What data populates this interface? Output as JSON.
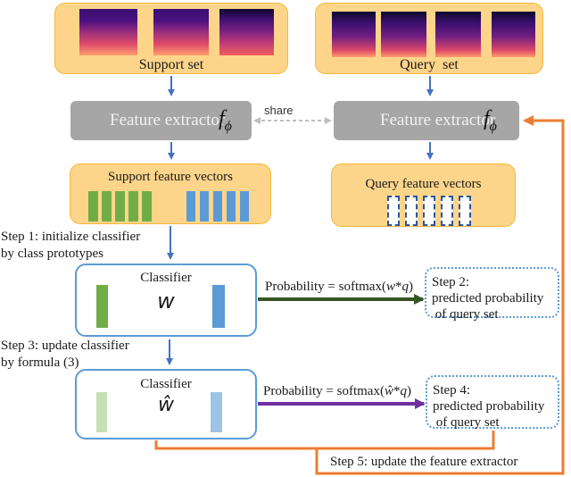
{
  "support_set": {
    "label": "Support set",
    "spectrogram_count": 3
  },
  "query_set": {
    "label": "Query  set",
    "spectrogram_count": 4
  },
  "feature_extractor_left": {
    "label": "Feature extractor",
    "symbol": "f",
    "subscript": "ϕ"
  },
  "feature_extractor_right": {
    "label": "Feature extractor",
    "symbol": "f",
    "subscript": "ϕ"
  },
  "share_label": "share",
  "support_vectors": {
    "label": "Support feature vectors",
    "green_count": 5,
    "blue_count": 5
  },
  "query_vectors": {
    "label": "Query feature vectors",
    "count": 5
  },
  "step1": {
    "line1": "Step 1: initialize classifier",
    "line2": "by class prototypes"
  },
  "classifier1": {
    "title": "Classifier",
    "symbol": "w"
  },
  "prob1": {
    "prefix": "Probability = softmax(",
    "w": "w",
    "rest": "*",
    "q": "q",
    "suffix": ")"
  },
  "step2": {
    "line1": "Step 2:",
    "line2": "predicted probability",
    "line3": " of query set"
  },
  "step3": {
    "line1": "Step 3: update classifier",
    "line2": "by formula (3)"
  },
  "classifier2": {
    "title": "Classifier",
    "symbol": "ŵ"
  },
  "prob2": {
    "prefix": "Probability = softmax(",
    "w": "ŵ",
    "rest": "*",
    "q": "q",
    "suffix": ")"
  },
  "step4": {
    "line1": "Step 4:",
    "line2": "predicted probability",
    "line3": " of query set"
  },
  "step5": {
    "label": "Step 5: update the feature extractor"
  },
  "colors": {
    "box_fill": "#fdd58a",
    "box_border": "#f5b73b",
    "extractor_fill": "#a6a6a6",
    "green_vector": "#70ad47",
    "blue_vector": "#5b9bd5",
    "light_green_vector": "#c5e0b4",
    "light_blue_vector": "#9dc3e6",
    "flow_arrow": "#4472c4",
    "arrow_green": "#375623",
    "arrow_purple": "#7030a0",
    "arrow_orange": "#ed7d31",
    "share_arrow": "#bfbfbf"
  }
}
